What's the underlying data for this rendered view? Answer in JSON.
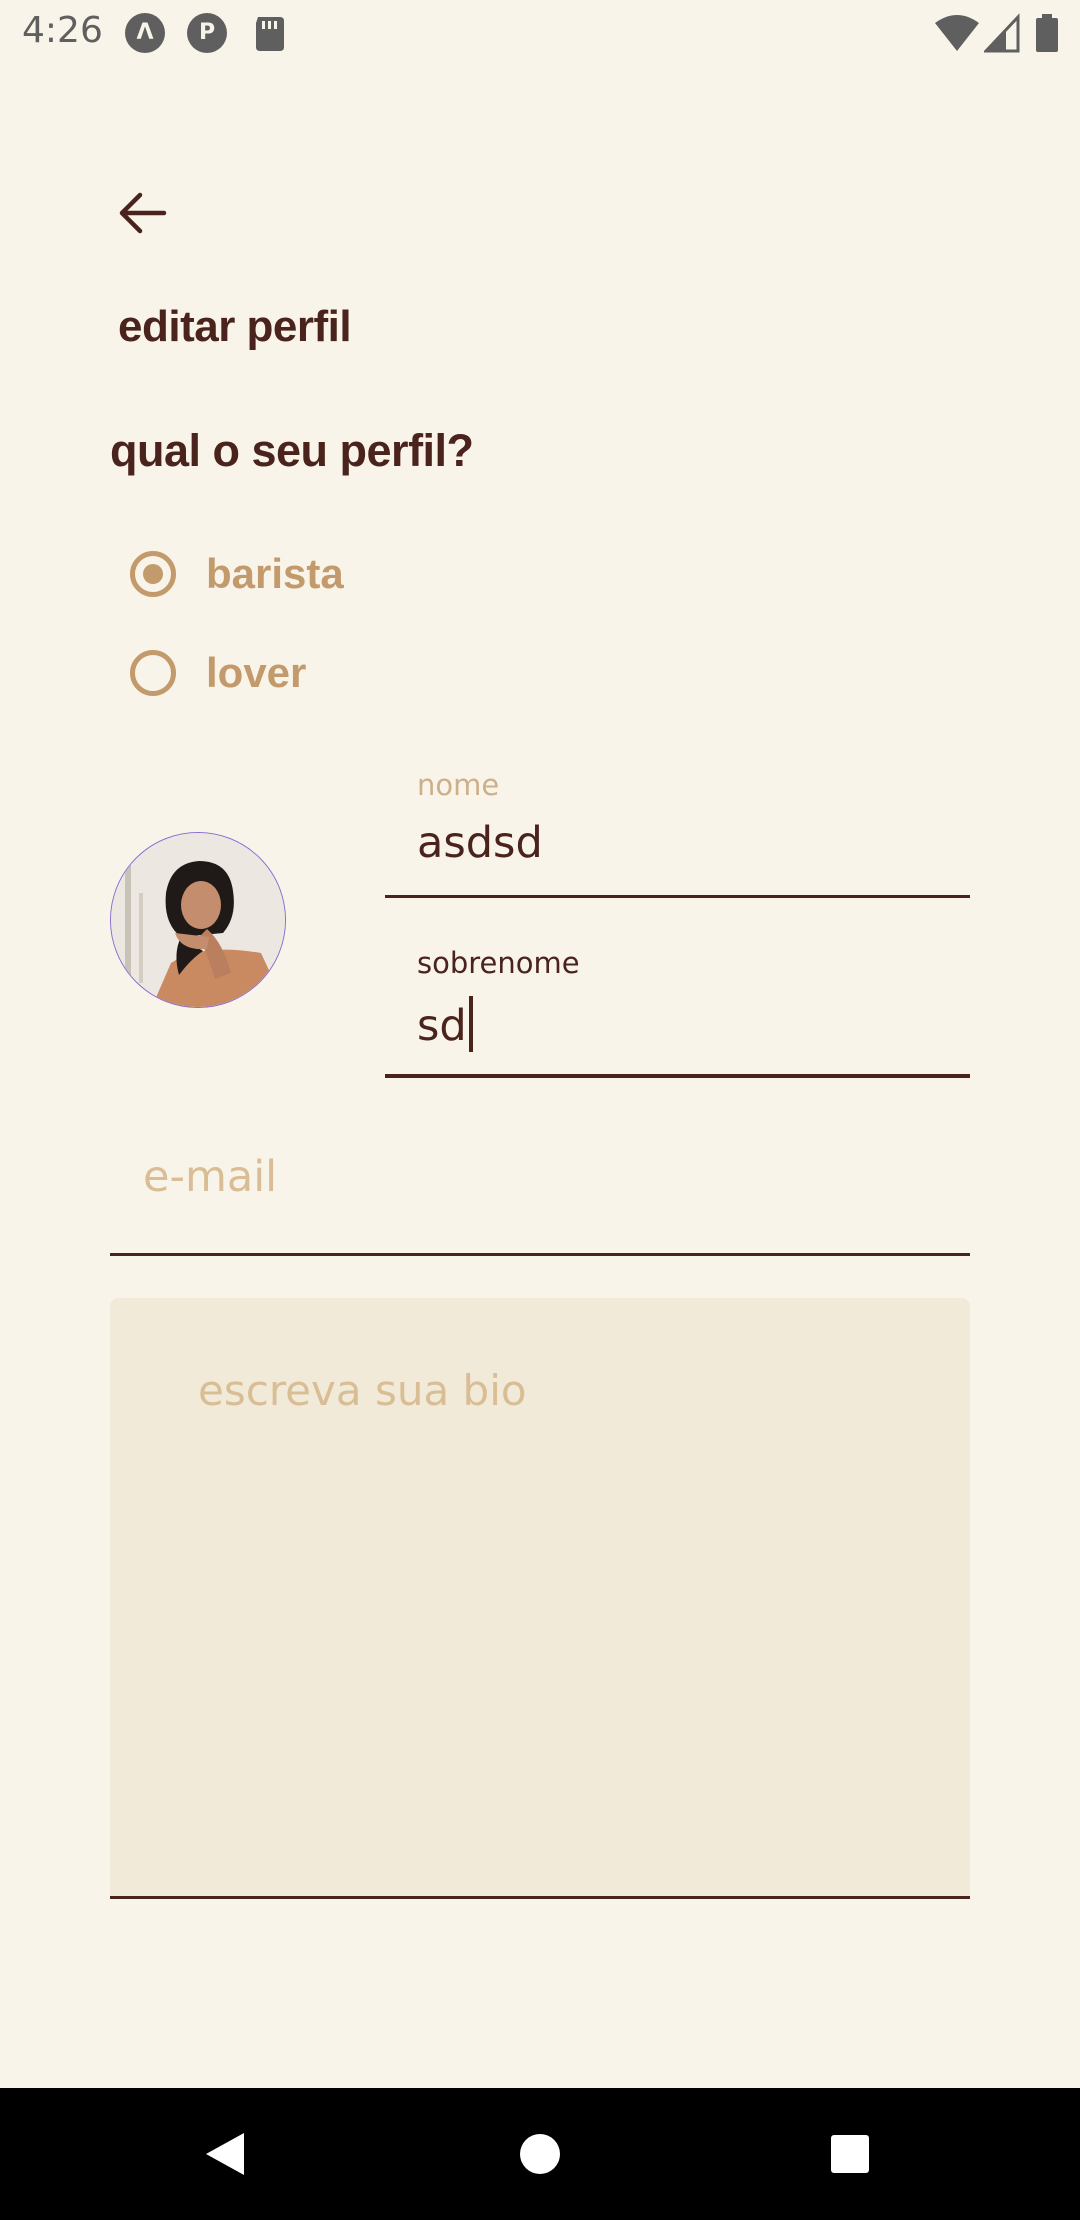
{
  "status_bar": {
    "time": "4:26",
    "icons": [
      "app-a-icon",
      "app-p-icon",
      "sd-card-icon",
      "wifi-icon",
      "cell-signal-icon",
      "battery-icon"
    ]
  },
  "header": {
    "back_icon": "arrow-left-icon",
    "title": "editar perfil"
  },
  "profile_question": "qual o seu perfil?",
  "profile_options": [
    {
      "label": "barista",
      "selected": true
    },
    {
      "label": "lover",
      "selected": false
    }
  ],
  "avatar": {
    "icon": "profile-photo"
  },
  "fields": {
    "nome": {
      "label": "nome",
      "value": "asdsd"
    },
    "sobrenome": {
      "label": "sobrenome",
      "value": "sd"
    },
    "email": {
      "placeholder": "e-mail",
      "value": ""
    }
  },
  "bio": {
    "placeholder": "escreva sua bio",
    "value": ""
  },
  "nav_bar": {
    "buttons": [
      "back-triangle-icon",
      "home-circle-icon",
      "recents-square-icon"
    ]
  },
  "colors": {
    "background": "#F9F4EA",
    "primary_dark": "#4A241C",
    "accent_tan": "#C39A6B",
    "placeholder": "#D9BE95",
    "bio_bg": "#F2EAD9"
  }
}
